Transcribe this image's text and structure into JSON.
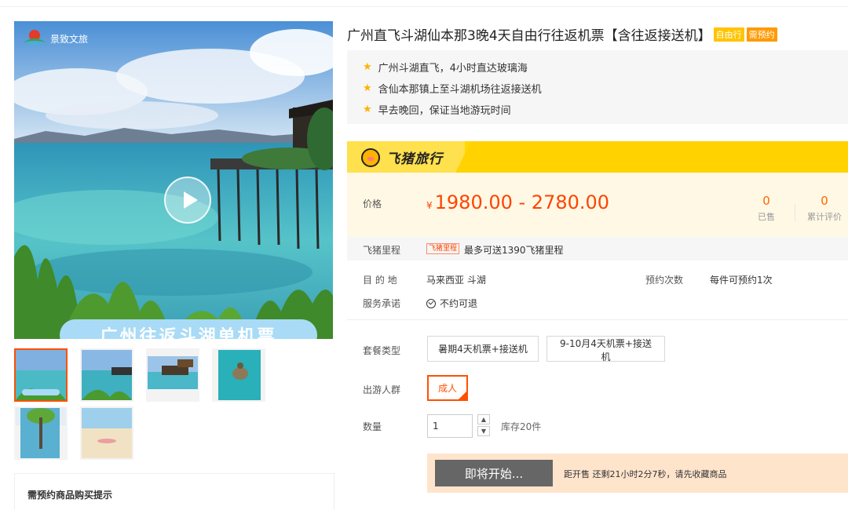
{
  "gallery": {
    "logo_text": "景致文旅",
    "banner_text": "广州往返斗湖单机票",
    "thumbnails": [
      "sea-pier",
      "sea-pier-2",
      "sea-house",
      "turtle",
      "tree-reflection",
      "beach"
    ]
  },
  "notice": {
    "title": "需预约商品购买提示"
  },
  "product": {
    "title": "广州直飞斗湖仙本那3晚4天自由行往返机票【含往返接送机】",
    "tags": [
      "自由行",
      "需预约"
    ],
    "features": [
      "广州斗湖直飞，4小时直达玻璃海",
      "含仙本那镇上至斗湖机场往返接送机",
      "早去晚回，保证当地游玩时间"
    ]
  },
  "brand": {
    "name": "飞猪旅行"
  },
  "price": {
    "label": "价格",
    "currency": "¥",
    "range": "1980.00 - 2780.00",
    "sold_count": "0",
    "sold_label": "已售",
    "review_count": "0",
    "review_label": "累计评价"
  },
  "miles": {
    "label": "飞猪里程",
    "badge": "飞猪里程",
    "text": "最多可送1390飞猪里程"
  },
  "info": {
    "destination_label": "目 的 地",
    "destination": "马来西亚  斗湖",
    "booking_label": "预约次数",
    "booking_value": "每件可预约1次",
    "promise_label": "服务承诺",
    "promise_value": "不约可退"
  },
  "options": {
    "package_label": "套餐类型",
    "packages": [
      "暑期4天机票+接送机",
      "9-10月4天机票+接送机"
    ],
    "crowd_label": "出游人群",
    "crowd": "成人",
    "qty_label": "数量",
    "qty_value": "1",
    "stock": "库存20件"
  },
  "buy": {
    "button": "即将开始...",
    "countdown": "距开售 还剩21小时2分7秒，请先收藏商品"
  },
  "colors": {
    "accent": "#ff5000",
    "price": "#ff4400",
    "fliggy_yellow": "#ffd900"
  }
}
